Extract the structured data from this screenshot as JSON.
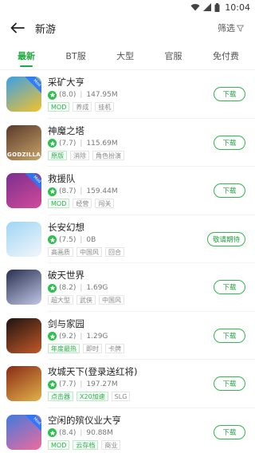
{
  "status_bar": {
    "time": "10:04"
  },
  "header": {
    "title": "新游",
    "filter_label": "筛选"
  },
  "tabs": [
    {
      "label": "最新",
      "active": true
    },
    {
      "label": "BT服",
      "active": false
    },
    {
      "label": "大型",
      "active": false
    },
    {
      "label": "官服",
      "active": false
    },
    {
      "label": "免付费",
      "active": false
    }
  ],
  "games": [
    {
      "name": "采矿大亨",
      "rating": "(8.0)",
      "size": "147.95M",
      "tags": [
        {
          "text": "MOD",
          "style": "green"
        },
        {
          "text": "养成",
          "style": ""
        },
        {
          "text": "挂机",
          "style": ""
        }
      ],
      "button": "下载",
      "thumb_colors": [
        "#3aa0e8",
        "#f3c22b"
      ],
      "thumb_text": "",
      "corner": "Mod"
    },
    {
      "name": "神魔之塔",
      "rating": "(7.7)",
      "size": "115.69M",
      "tags": [
        {
          "text": "原版",
          "style": "green"
        },
        {
          "text": "消除",
          "style": ""
        },
        {
          "text": "角色扮演",
          "style": ""
        }
      ],
      "button": "下载",
      "thumb_colors": [
        "#5a3a2a",
        "#c9a46a"
      ],
      "thumb_text": "GODZILLA",
      "corner": ""
    },
    {
      "name": "救援队",
      "rating": "(8.7)",
      "size": "159.44M",
      "tags": [
        {
          "text": "MOD",
          "style": "green"
        },
        {
          "text": "经营",
          "style": ""
        },
        {
          "text": "闯关",
          "style": ""
        }
      ],
      "button": "下载",
      "thumb_colors": [
        "#7a2f8f",
        "#d24a9a"
      ],
      "thumb_text": "",
      "corner": "Mod"
    },
    {
      "name": "长安幻想",
      "rating": "(7.5)",
      "size": "0B",
      "tags": [
        {
          "text": "高画质",
          "style": ""
        },
        {
          "text": "中国风",
          "style": ""
        },
        {
          "text": "回合",
          "style": ""
        }
      ],
      "button": "敬请期待",
      "thumb_colors": [
        "#9ed6f5",
        "#f2f6fb"
      ],
      "thumb_text": "",
      "corner": ""
    },
    {
      "name": "破天世界",
      "rating": "(8.2)",
      "size": "1.69G",
      "tags": [
        {
          "text": "超大型",
          "style": ""
        },
        {
          "text": "武侠",
          "style": ""
        },
        {
          "text": "中国风",
          "style": ""
        }
      ],
      "button": "下载",
      "thumb_colors": [
        "#2a2f4f",
        "#c0c8e6"
      ],
      "thumb_text": "",
      "corner": ""
    },
    {
      "name": "剑与家园",
      "rating": "(9.2)",
      "size": "1.29G",
      "tags": [
        {
          "text": "年度最热",
          "style": "green"
        },
        {
          "text": "即时",
          "style": ""
        },
        {
          "text": "卡牌",
          "style": ""
        }
      ],
      "button": "下载",
      "thumb_colors": [
        "#1e1410",
        "#c2592a"
      ],
      "thumb_text": "",
      "corner": ""
    },
    {
      "name": "攻城天下(登录送红将)",
      "rating": "(7.7)",
      "size": "197.27M",
      "tags": [
        {
          "text": "点击器",
          "style": "green"
        },
        {
          "text": "X20加速",
          "style": "green"
        },
        {
          "text": "SLG",
          "style": ""
        }
      ],
      "button": "下载",
      "thumb_colors": [
        "#8a2a16",
        "#e2b24a"
      ],
      "thumb_text": "",
      "corner": ""
    },
    {
      "name": "空闲的殡仪业大亨",
      "rating": "(8.4)",
      "size": "90.88M",
      "tags": [
        {
          "text": "MOD",
          "style": "green"
        },
        {
          "text": "云存档",
          "style": "green"
        },
        {
          "text": "商业",
          "style": ""
        }
      ],
      "button": "下载",
      "thumb_colors": [
        "#3f7be0",
        "#f06a9a"
      ],
      "thumb_text": "",
      "corner": "Mod"
    }
  ],
  "colors": {
    "accent": "#1faa3e"
  }
}
